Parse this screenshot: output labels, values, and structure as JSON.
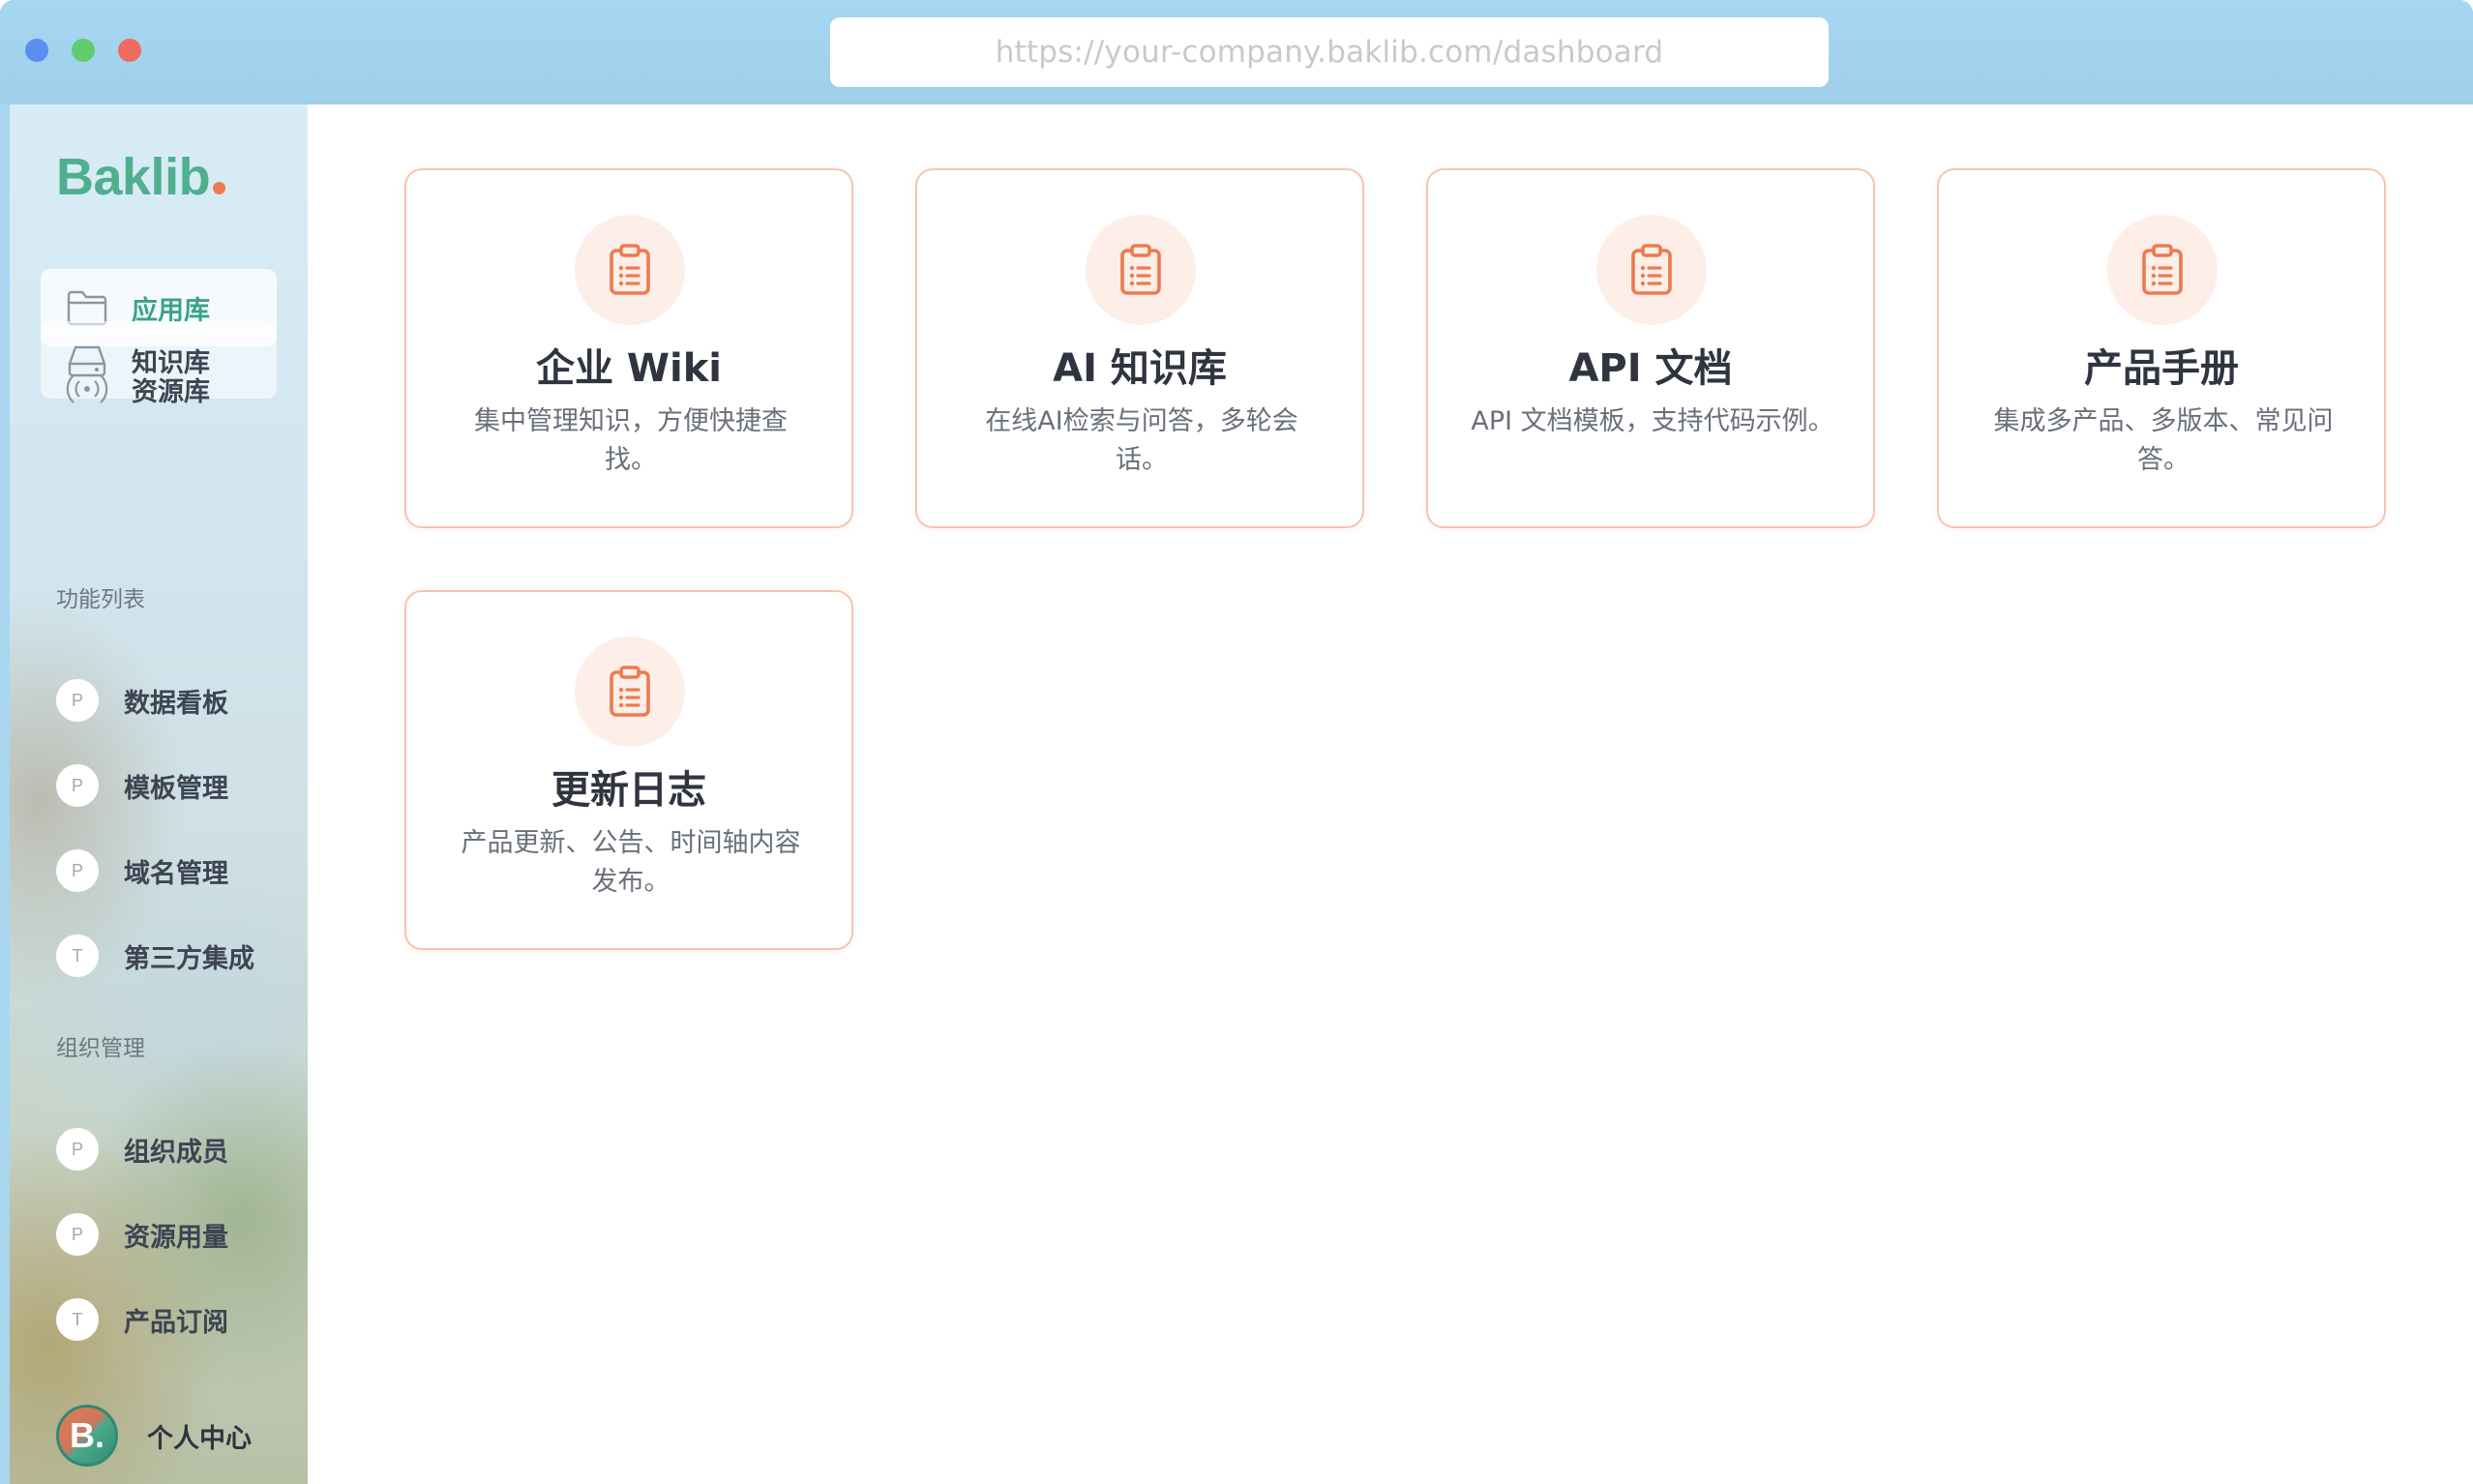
{
  "browser": {
    "url": "https://your-company.baklib.com/dashboard"
  },
  "sidebar": {
    "logo": "Baklib",
    "nav": [
      {
        "label": "应用库",
        "icon": "folder-icon",
        "active": true
      },
      {
        "label": "知识库",
        "icon": "drive-icon",
        "active": false
      },
      {
        "label": "资源库",
        "icon": "broadcast-icon",
        "active": false
      }
    ],
    "features_title": "功能列表",
    "features": [
      {
        "badge": "P",
        "label": "数据看板"
      },
      {
        "badge": "P",
        "label": "模板管理"
      },
      {
        "badge": "P",
        "label": "域名管理"
      },
      {
        "badge": "T",
        "label": "第三方集成"
      }
    ],
    "org_title": "组织管理",
    "org": [
      {
        "badge": "P",
        "label": "组织成员"
      },
      {
        "badge": "P",
        "label": "资源用量"
      },
      {
        "badge": "T",
        "label": "产品订阅"
      }
    ],
    "user": {
      "avatar_text": "B.",
      "label": "个人中心"
    }
  },
  "cards": [
    {
      "title": "企业 Wiki",
      "desc": "集中管理知识，方便快捷查找。",
      "icon": "clipboard-icon"
    },
    {
      "title": "AI 知识库",
      "desc": "在线AI检索与问答，多轮会话。",
      "icon": "clipboard-icon"
    },
    {
      "title": "API 文档",
      "desc": "API 文档模板，支持代码示例。",
      "icon": "clipboard-icon"
    },
    {
      "title": "产品手册",
      "desc": "集成多产品、多版本、常见问答。",
      "icon": "clipboard-icon"
    },
    {
      "title": "更新日志",
      "desc": "产品更新、公告、时间轴内容发布。",
      "icon": "clipboard-icon"
    }
  ],
  "colors": {
    "accent_green": "#3aa387",
    "accent_orange": "#ef7a50",
    "card_border": "#f6c4ad"
  }
}
